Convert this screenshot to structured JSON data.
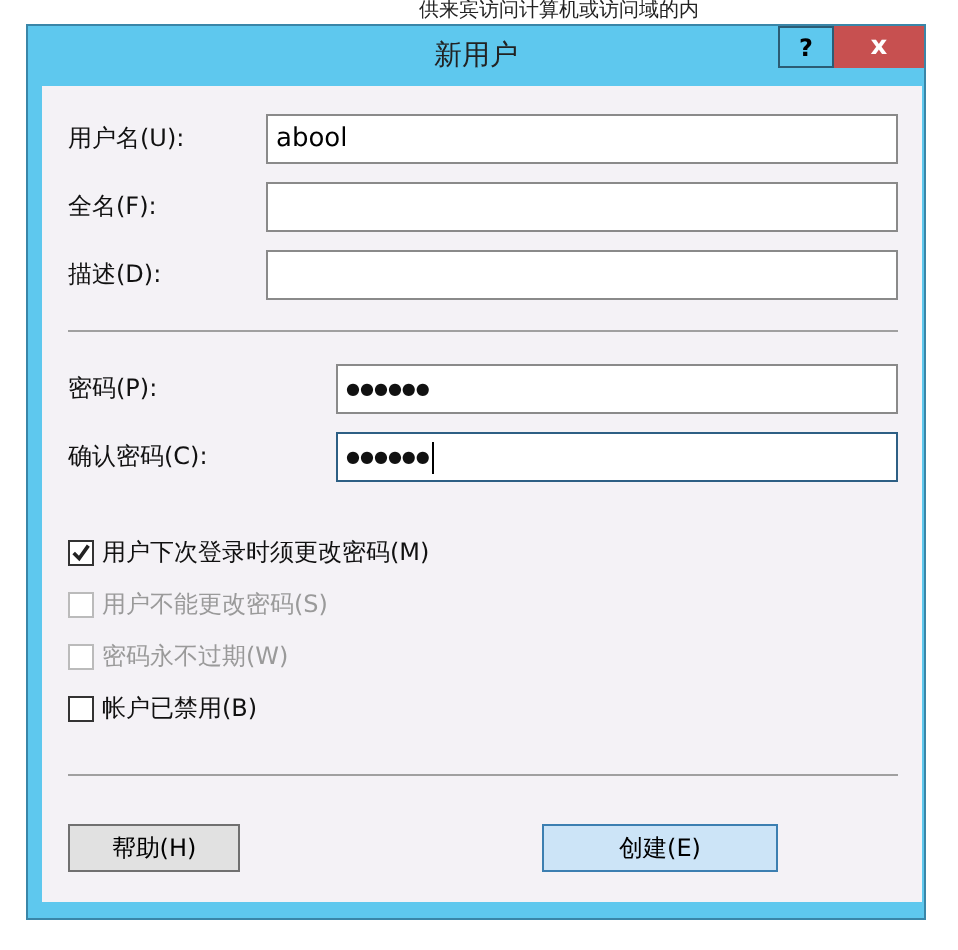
{
  "background_text": "供来宾访问计算机或访问域的内",
  "window": {
    "title": "新用户",
    "help_button": "?",
    "close_button": "x"
  },
  "account_fields": [
    {
      "label": "用户名(U):",
      "value": "abool"
    },
    {
      "label": "全名(F):"
    },
    {
      "label": "描述(D):"
    }
  ],
  "password_fields": [
    {
      "label": "密码(P):",
      "value": "●●●●●●",
      "focused": false
    },
    {
      "label": "确认密码(C):",
      "value": "●●●●●●",
      "focused": true
    }
  ],
  "options": [
    {
      "label": "用户下次登录时须更改密码(M)",
      "checked": true,
      "disabled": false
    },
    {
      "label": "用户不能更改密码(S)",
      "checked": false,
      "disabled": true
    },
    {
      "label": "密码永不过期(W)",
      "checked": false,
      "disabled": true
    },
    {
      "label": "帐户已禁用(B)",
      "checked": false,
      "disabled": false
    }
  ],
  "buttons": [
    {
      "label": "帮助(H)",
      "default": false
    },
    {
      "label": "创建(E)",
      "default": true
    }
  ]
}
